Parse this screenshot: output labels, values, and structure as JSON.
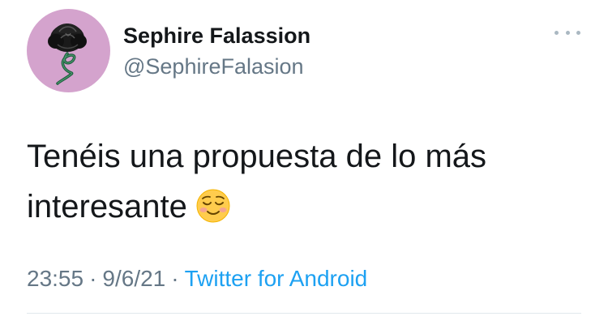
{
  "user": {
    "display_name": "Sephire Falassion",
    "handle": "@SephireFalasion",
    "avatar_icon": "black-rose-avatar-icon",
    "avatar_bg": "#d4a3cd"
  },
  "menu": {
    "icon": "more-options-icon"
  },
  "tweet": {
    "line1": "Tenéis una propuesta de lo más",
    "line2": "interesante",
    "emoji": "smiling-face-icon"
  },
  "meta": {
    "time": "23:55",
    "separator": "·",
    "date": "9/6/21",
    "source": "Twitter for Android"
  },
  "colors": {
    "text": "#14171a",
    "secondary": "#657786",
    "link": "#1da1f2",
    "divider": "#e1e8ed"
  }
}
